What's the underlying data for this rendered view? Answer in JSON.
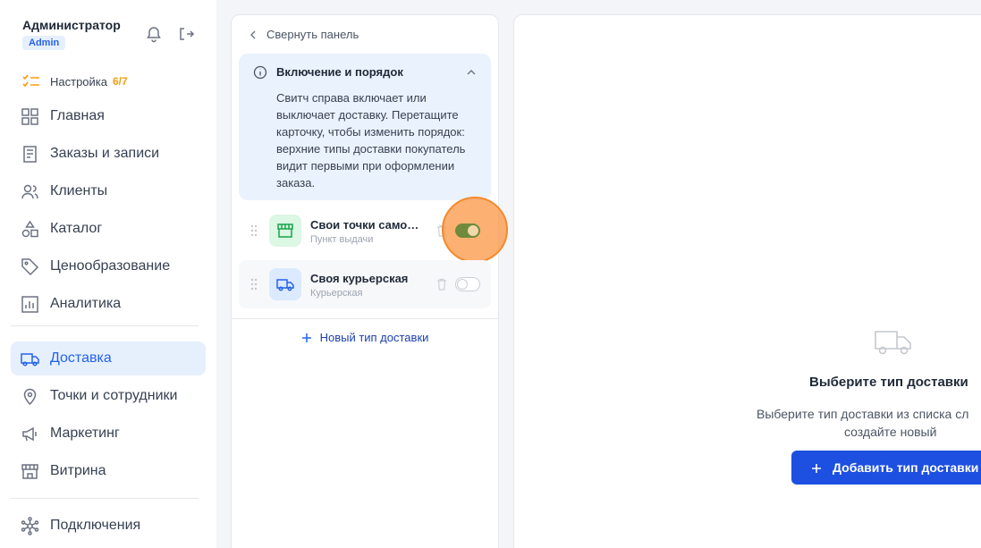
{
  "user": {
    "name": "Администратор",
    "role": "Admin"
  },
  "header_icons": [
    "bell-icon",
    "logout-icon"
  ],
  "setup": {
    "label": "Настройка",
    "count": "6/7"
  },
  "nav": [
    {
      "id": "home",
      "label": "Главная",
      "icon": "grid-icon"
    },
    {
      "id": "orders",
      "label": "Заказы и записи",
      "icon": "receipt-icon"
    },
    {
      "id": "clients",
      "label": "Клиенты",
      "icon": "users-icon"
    },
    {
      "id": "catalog",
      "label": "Каталог",
      "icon": "shapes-icon"
    },
    {
      "id": "pricing",
      "label": "Ценообразование",
      "icon": "tag-icon"
    },
    {
      "id": "analytics",
      "label": "Аналитика",
      "icon": "chart-icon"
    },
    {
      "id": "delivery",
      "label": "Доставка",
      "icon": "truck-icon",
      "active": true
    },
    {
      "id": "points",
      "label": "Точки и сотрудники",
      "icon": "location-icon"
    },
    {
      "id": "marketing",
      "label": "Маркетинг",
      "icon": "megaphone-icon"
    },
    {
      "id": "storefront",
      "label": "Витрина",
      "icon": "store-icon"
    },
    {
      "id": "integrations",
      "label": "Подключения",
      "icon": "network-icon"
    }
  ],
  "panel": {
    "collapse_label": "Свернуть панель",
    "info": {
      "title": "Включение и порядок",
      "text": "Свитч справа включает или выключает доставку. Перетащите карточку, чтобы изменить порядок: верхние типы доставки покупатель видит первыми при оформлении заказа."
    },
    "delivery_types": [
      {
        "name": "Свои точки самовывоза",
        "subtitle": "Пункт выдачи",
        "icon": "store-icon",
        "enabled": true,
        "icon_bg": "#dcf7e4",
        "icon_color": "#16a34a"
      },
      {
        "name": "Своя курьерская",
        "subtitle": "Курьерская",
        "icon": "truck-icon",
        "enabled": false,
        "icon_bg": "#dbeafe",
        "icon_color": "#2563eb"
      }
    ],
    "add_label": "Новый тип доставки"
  },
  "detail": {
    "empty_title": "Выберите тип доставки",
    "empty_text_line1": "Выберите тип доставки из списка сл",
    "empty_text_line2": "создайте новый",
    "add_button": "Добавить тип доставки"
  },
  "colors": {
    "accent": "#2563eb",
    "primary_button": "#1d4fe0",
    "warning": "#f59e0b",
    "highlight": "#fb923c"
  }
}
